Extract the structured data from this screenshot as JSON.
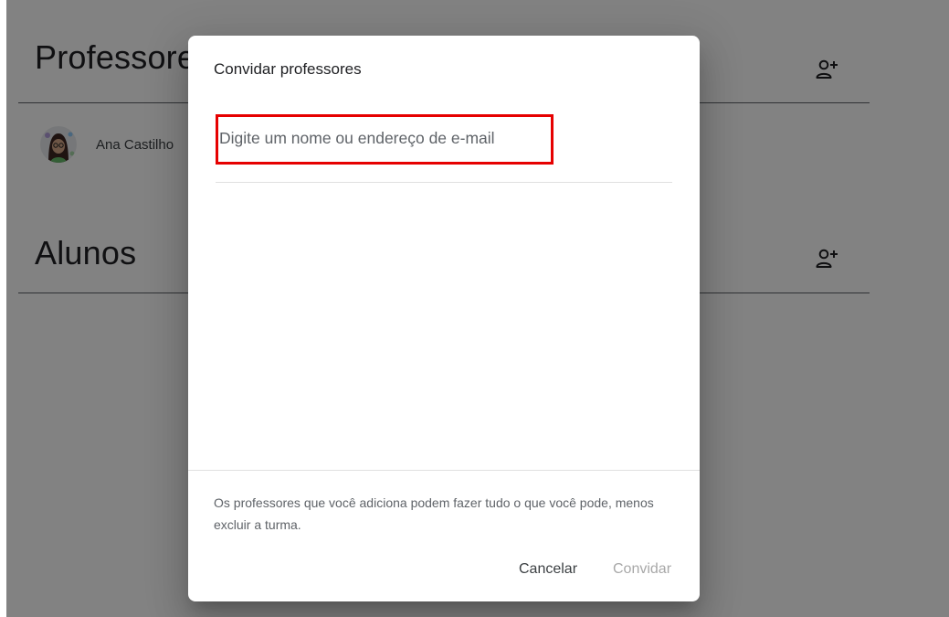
{
  "background": {
    "teachers_section": {
      "title": "Professores",
      "add_icon": "person-add-icon",
      "members": [
        {
          "name": "Ana Castilho",
          "avatar_icon": "avatar-image"
        }
      ]
    },
    "students_section": {
      "title": "Alunos",
      "add_icon": "person-add-icon"
    }
  },
  "dialog": {
    "title": "Convidar professores",
    "input": {
      "placeholder": "Digite um nome ou endereço de e-mail",
      "value": "",
      "highlight_color": "#e60000"
    },
    "note": "Os professores que você adiciona podem fazer tudo o que você pode, menos excluir a turma.",
    "buttons": {
      "cancel": "Cancelar",
      "invite": "Convidar"
    }
  }
}
